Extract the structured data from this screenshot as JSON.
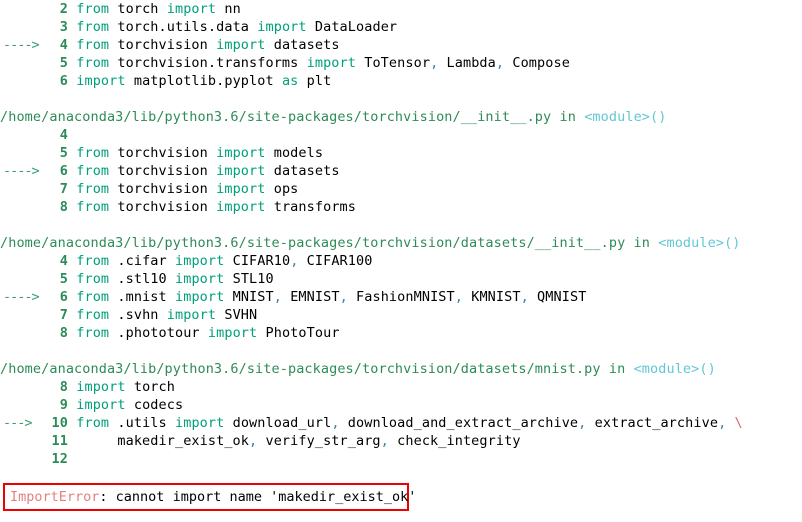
{
  "page": {
    "kind": "python-traceback",
    "background_color": "#ffffff",
    "colors": {
      "path": "#2e8b57",
      "scope": "#63c7d4",
      "keyword": "#00a07a",
      "line_number": "#2e8b57",
      "arrow": "#3a9e6e",
      "punctuation": "#3f7f9f",
      "continuation": "#d46a6a",
      "error_type": "#e58080",
      "error_border": "#ee0000",
      "plain_text": "#000000"
    }
  },
  "traceback": {
    "frames": [
      {
        "location": null,
        "lines": [
          {
            "arrow": "",
            "number": "2",
            "segments": [
              {
                "t": "from",
                "c": "kw"
              },
              {
                "t": " torch ",
                "c": "plain"
              },
              {
                "t": "import",
                "c": "kw"
              },
              {
                "t": " nn",
                "c": "plain"
              }
            ]
          },
          {
            "arrow": "",
            "number": "3",
            "segments": [
              {
                "t": "from",
                "c": "kw"
              },
              {
                "t": " torch.utils.data ",
                "c": "plain"
              },
              {
                "t": "import",
                "c": "kw"
              },
              {
                "t": " DataLoader",
                "c": "plain"
              }
            ]
          },
          {
            "arrow": "---->",
            "number": "4",
            "segments": [
              {
                "t": "from",
                "c": "kw"
              },
              {
                "t": " torchvision ",
                "c": "plain"
              },
              {
                "t": "import",
                "c": "kw"
              },
              {
                "t": " datasets",
                "c": "plain"
              }
            ]
          },
          {
            "arrow": "",
            "number": "5",
            "segments": [
              {
                "t": "from",
                "c": "kw"
              },
              {
                "t": " torchvision.transforms ",
                "c": "plain"
              },
              {
                "t": "import",
                "c": "kw"
              },
              {
                "t": " ToTensor",
                "c": "plain"
              },
              {
                "t": ",",
                "c": "punc"
              },
              {
                "t": " Lambda",
                "c": "plain"
              },
              {
                "t": ",",
                "c": "punc"
              },
              {
                "t": " Compose",
                "c": "plain"
              }
            ]
          },
          {
            "arrow": "",
            "number": "6",
            "segments": [
              {
                "t": "import",
                "c": "kw"
              },
              {
                "t": " matplotlib.pyplot ",
                "c": "plain"
              },
              {
                "t": "as",
                "c": "kw"
              },
              {
                "t": " plt",
                "c": "plain"
              }
            ]
          }
        ]
      },
      {
        "location": {
          "path": "/home/anaconda3/lib/python3.6/site-packages/torchvision/__init__.py",
          "in": "in",
          "scope": "<module>()"
        },
        "lines": [
          {
            "arrow": "",
            "number": "4",
            "segments": []
          },
          {
            "arrow": "",
            "number": "5",
            "segments": [
              {
                "t": "from",
                "c": "kw"
              },
              {
                "t": " torchvision ",
                "c": "plain"
              },
              {
                "t": "import",
                "c": "kw"
              },
              {
                "t": " models",
                "c": "plain"
              }
            ]
          },
          {
            "arrow": "---->",
            "number": "6",
            "segments": [
              {
                "t": "from",
                "c": "kw"
              },
              {
                "t": " torchvision ",
                "c": "plain"
              },
              {
                "t": "import",
                "c": "kw"
              },
              {
                "t": " datasets",
                "c": "plain"
              }
            ]
          },
          {
            "arrow": "",
            "number": "7",
            "segments": [
              {
                "t": "from",
                "c": "kw"
              },
              {
                "t": " torchvision ",
                "c": "plain"
              },
              {
                "t": "import",
                "c": "kw"
              },
              {
                "t": " ops",
                "c": "plain"
              }
            ]
          },
          {
            "arrow": "",
            "number": "8",
            "segments": [
              {
                "t": "from",
                "c": "kw"
              },
              {
                "t": " torchvision ",
                "c": "plain"
              },
              {
                "t": "import",
                "c": "kw"
              },
              {
                "t": " transforms",
                "c": "plain"
              }
            ]
          }
        ]
      },
      {
        "location": {
          "path": "/home/anaconda3/lib/python3.6/site-packages/torchvision/datasets/__init__.py",
          "in": "in",
          "scope": "<module>()"
        },
        "lines": [
          {
            "arrow": "",
            "number": "4",
            "segments": [
              {
                "t": "from",
                "c": "kw"
              },
              {
                "t": " .cifar ",
                "c": "plain"
              },
              {
                "t": "import",
                "c": "kw"
              },
              {
                "t": " CIFAR10",
                "c": "plain"
              },
              {
                "t": ",",
                "c": "punc"
              },
              {
                "t": " CIFAR100",
                "c": "plain"
              }
            ]
          },
          {
            "arrow": "",
            "number": "5",
            "segments": [
              {
                "t": "from",
                "c": "kw"
              },
              {
                "t": " .stl10 ",
                "c": "plain"
              },
              {
                "t": "import",
                "c": "kw"
              },
              {
                "t": " STL10",
                "c": "plain"
              }
            ]
          },
          {
            "arrow": "---->",
            "number": "6",
            "segments": [
              {
                "t": "from",
                "c": "kw"
              },
              {
                "t": " .mnist ",
                "c": "plain"
              },
              {
                "t": "import",
                "c": "kw"
              },
              {
                "t": " MNIST",
                "c": "plain"
              },
              {
                "t": ",",
                "c": "punc"
              },
              {
                "t": " EMNIST",
                "c": "plain"
              },
              {
                "t": ",",
                "c": "punc"
              },
              {
                "t": " FashionMNIST",
                "c": "plain"
              },
              {
                "t": ",",
                "c": "punc"
              },
              {
                "t": " KMNIST",
                "c": "plain"
              },
              {
                "t": ",",
                "c": "punc"
              },
              {
                "t": " QMNIST",
                "c": "plain"
              }
            ]
          },
          {
            "arrow": "",
            "number": "7",
            "segments": [
              {
                "t": "from",
                "c": "kw"
              },
              {
                "t": " .svhn ",
                "c": "plain"
              },
              {
                "t": "import",
                "c": "kw"
              },
              {
                "t": " SVHN",
                "c": "plain"
              }
            ]
          },
          {
            "arrow": "",
            "number": "8",
            "segments": [
              {
                "t": "from",
                "c": "kw"
              },
              {
                "t": " .phototour ",
                "c": "plain"
              },
              {
                "t": "import",
                "c": "kw"
              },
              {
                "t": " PhotoTour",
                "c": "plain"
              }
            ]
          }
        ]
      },
      {
        "location": {
          "path": "/home/anaconda3/lib/python3.6/site-packages/torchvision/datasets/mnist.py",
          "in": "in",
          "scope": "<module>()"
        },
        "lines": [
          {
            "arrow": "",
            "number": "8",
            "segments": [
              {
                "t": "import",
                "c": "kw"
              },
              {
                "t": " torch",
                "c": "plain"
              }
            ]
          },
          {
            "arrow": "",
            "number": "9",
            "segments": [
              {
                "t": "import",
                "c": "kw"
              },
              {
                "t": " codecs",
                "c": "plain"
              }
            ]
          },
          {
            "arrow": "--->",
            "number": "10",
            "segments": [
              {
                "t": "from",
                "c": "kw"
              },
              {
                "t": " .utils ",
                "c": "plain"
              },
              {
                "t": "import",
                "c": "kw"
              },
              {
                "t": " download_url",
                "c": "plain"
              },
              {
                "t": ",",
                "c": "punc"
              },
              {
                "t": " download_and_extract_archive",
                "c": "plain"
              },
              {
                "t": ",",
                "c": "punc"
              },
              {
                "t": " extract_archive",
                "c": "plain"
              },
              {
                "t": ",",
                "c": "punc"
              },
              {
                "t": " ",
                "c": "plain"
              },
              {
                "t": "\\",
                "c": "cont"
              }
            ]
          },
          {
            "arrow": "",
            "number": "11",
            "segments": [
              {
                "t": "     makedir_exist_ok",
                "c": "plain"
              },
              {
                "t": ",",
                "c": "punc"
              },
              {
                "t": " verify_str_arg",
                "c": "plain"
              },
              {
                "t": ",",
                "c": "punc"
              },
              {
                "t": " check_integrity",
                "c": "plain"
              }
            ]
          },
          {
            "arrow": "",
            "number": "12",
            "segments": []
          }
        ]
      }
    ]
  },
  "error": {
    "type": "ImportError",
    "separator": ": ",
    "message": "cannot import name 'makedir_exist_ok'",
    "full_text": "ImportError: cannot import name 'makedir_exist_ok'"
  }
}
